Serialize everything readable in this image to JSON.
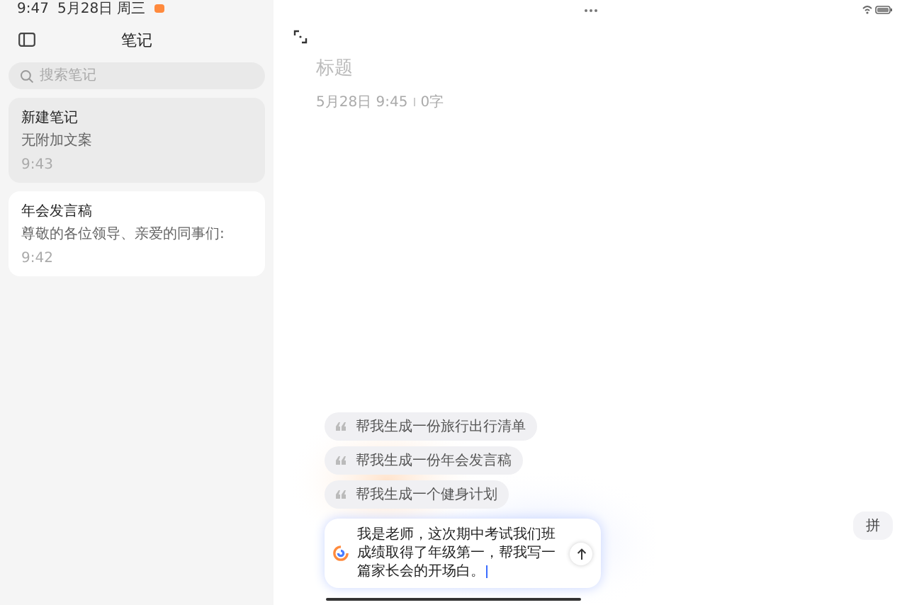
{
  "status_bar": {
    "time": "9:47",
    "date": "5月28日 周三"
  },
  "sidebar": {
    "title": "笔记",
    "search": {
      "placeholder": "搜索笔记"
    },
    "notes": [
      {
        "title": "新建笔记",
        "preview": "无附加文案",
        "time": "9:43",
        "selected": true
      },
      {
        "title": "年会发言稿",
        "preview": "尊敬的各位领导、亲爱的同事们:",
        "time": "9:42",
        "selected": false
      }
    ]
  },
  "editor": {
    "title_placeholder": "标题",
    "date": "5月28日 9:45",
    "word_count": "0字"
  },
  "assistant": {
    "suggestions": [
      "帮我生成一份旅行出行清单",
      "帮我生成一份年会发言稿",
      "帮我生成一个健身计划"
    ],
    "input_value": "我是老师，这次期中考试我们班成绩取得了年级第一，帮我写一篇家长会的开场白。"
  },
  "keyboard_toggle": "拼"
}
